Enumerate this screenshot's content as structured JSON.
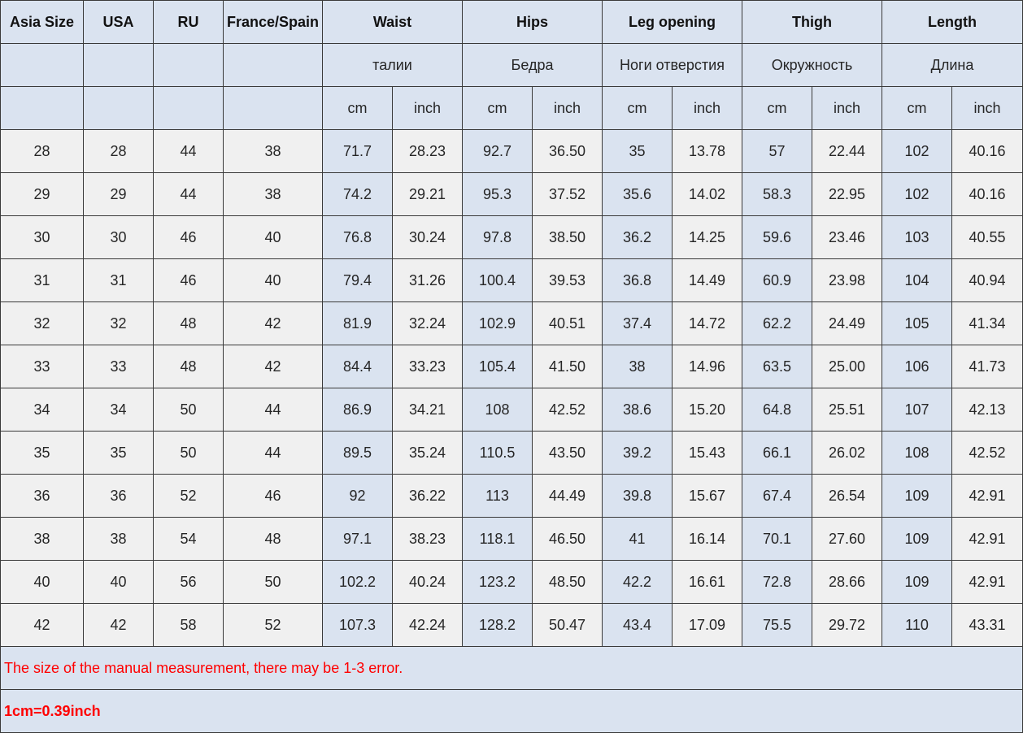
{
  "headers": {
    "row1": [
      "Asia Size",
      "USA",
      "RU",
      "France/Spain"
    ],
    "groups": [
      "Waist",
      "Hips",
      "Leg opening",
      "Thigh",
      "Length"
    ],
    "groups_ru": [
      "талии",
      "Бедра",
      "Ноги отверстия",
      "Окружность",
      "Длина"
    ],
    "unit_cm": "cm",
    "unit_inch": "inch"
  },
  "rows": [
    [
      "28",
      "28",
      "44",
      "38",
      "71.7",
      "28.23",
      "92.7",
      "36.50",
      "35",
      "13.78",
      "57",
      "22.44",
      "102",
      "40.16"
    ],
    [
      "29",
      "29",
      "44",
      "38",
      "74.2",
      "29.21",
      "95.3",
      "37.52",
      "35.6",
      "14.02",
      "58.3",
      "22.95",
      "102",
      "40.16"
    ],
    [
      "30",
      "30",
      "46",
      "40",
      "76.8",
      "30.24",
      "97.8",
      "38.50",
      "36.2",
      "14.25",
      "59.6",
      "23.46",
      "103",
      "40.55"
    ],
    [
      "31",
      "31",
      "46",
      "40",
      "79.4",
      "31.26",
      "100.4",
      "39.53",
      "36.8",
      "14.49",
      "60.9",
      "23.98",
      "104",
      "40.94"
    ],
    [
      "32",
      "32",
      "48",
      "42",
      "81.9",
      "32.24",
      "102.9",
      "40.51",
      "37.4",
      "14.72",
      "62.2",
      "24.49",
      "105",
      "41.34"
    ],
    [
      "33",
      "33",
      "48",
      "42",
      "84.4",
      "33.23",
      "105.4",
      "41.50",
      "38",
      "14.96",
      "63.5",
      "25.00",
      "106",
      "41.73"
    ],
    [
      "34",
      "34",
      "50",
      "44",
      "86.9",
      "34.21",
      "108",
      "42.52",
      "38.6",
      "15.20",
      "64.8",
      "25.51",
      "107",
      "42.13"
    ],
    [
      "35",
      "35",
      "50",
      "44",
      "89.5",
      "35.24",
      "110.5",
      "43.50",
      "39.2",
      "15.43",
      "66.1",
      "26.02",
      "108",
      "42.52"
    ],
    [
      "36",
      "36",
      "52",
      "46",
      "92",
      "36.22",
      "113",
      "44.49",
      "39.8",
      "15.67",
      "67.4",
      "26.54",
      "109",
      "42.91"
    ],
    [
      "38",
      "38",
      "54",
      "48",
      "97.1",
      "38.23",
      "118.1",
      "46.50",
      "41",
      "16.14",
      "70.1",
      "27.60",
      "109",
      "42.91"
    ],
    [
      "40",
      "40",
      "56",
      "50",
      "102.2",
      "40.24",
      "123.2",
      "48.50",
      "42.2",
      "16.61",
      "72.8",
      "28.66",
      "109",
      "42.91"
    ],
    [
      "42",
      "42",
      "58",
      "52",
      "107.3",
      "42.24",
      "128.2",
      "50.47",
      "43.4",
      "17.09",
      "75.5",
      "29.72",
      "110",
      "43.31"
    ]
  ],
  "notes": {
    "error_note": "The size of the manual measurement, there may be 1-3 error.",
    "conversion_note": "1cm=0.39inch"
  },
  "colors": {
    "header_bg": "#dae3f0",
    "cell_bg": "#f0f0f0",
    "note_text": "#ff0000"
  }
}
